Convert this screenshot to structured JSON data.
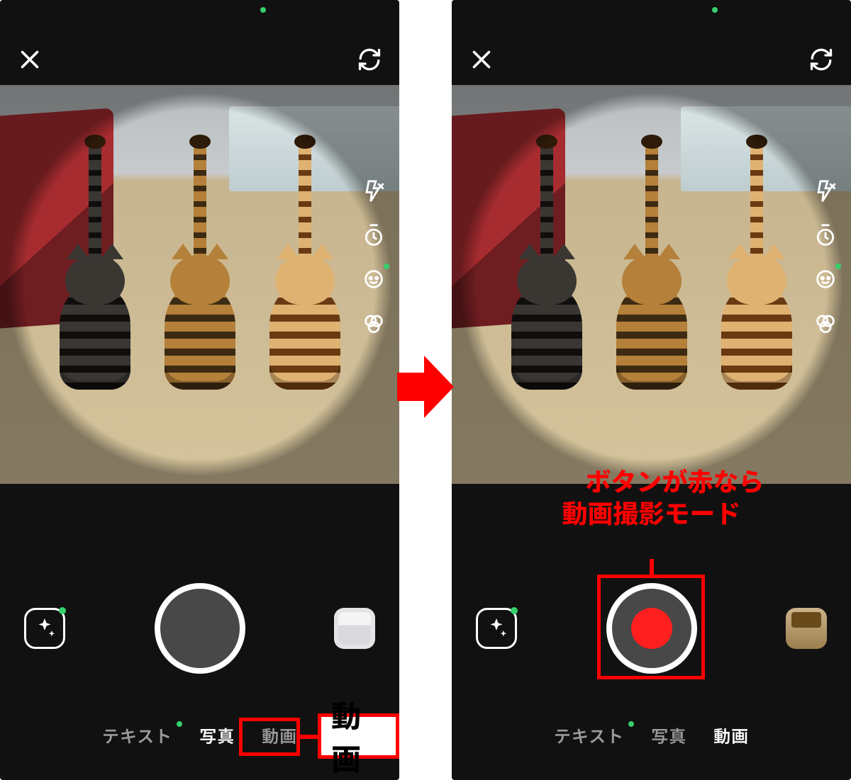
{
  "colors": {
    "accent_red": "#ff0000",
    "record_red": "#ff1f1f",
    "green_dot": "#35d06a"
  },
  "icons": {
    "close": "close-icon",
    "flip": "camera-flip-icon",
    "flash": "flash-off-icon",
    "timer": "timer-icon",
    "face": "face-effect-icon",
    "filter": "color-filter-icon",
    "effects": "effects-sparkle-icon"
  },
  "left": {
    "modes": {
      "text_label": "テキスト",
      "photo_label": "写真",
      "video_label": "動画",
      "active": "photo"
    },
    "shutter_state": "photo",
    "gallery_thumbnail": "placeholder",
    "annotation": {
      "highlighted_mode_label": "動画",
      "callout_label": "動画"
    }
  },
  "right": {
    "modes": {
      "text_label": "テキスト",
      "photo_label": "写真",
      "video_label": "動画",
      "active": "video"
    },
    "shutter_state": "video",
    "gallery_thumbnail": "photo",
    "annotation": {
      "shutter_box": true,
      "text_line1": "ボタンが赤なら",
      "text_line2": "動画撮影モード"
    }
  }
}
